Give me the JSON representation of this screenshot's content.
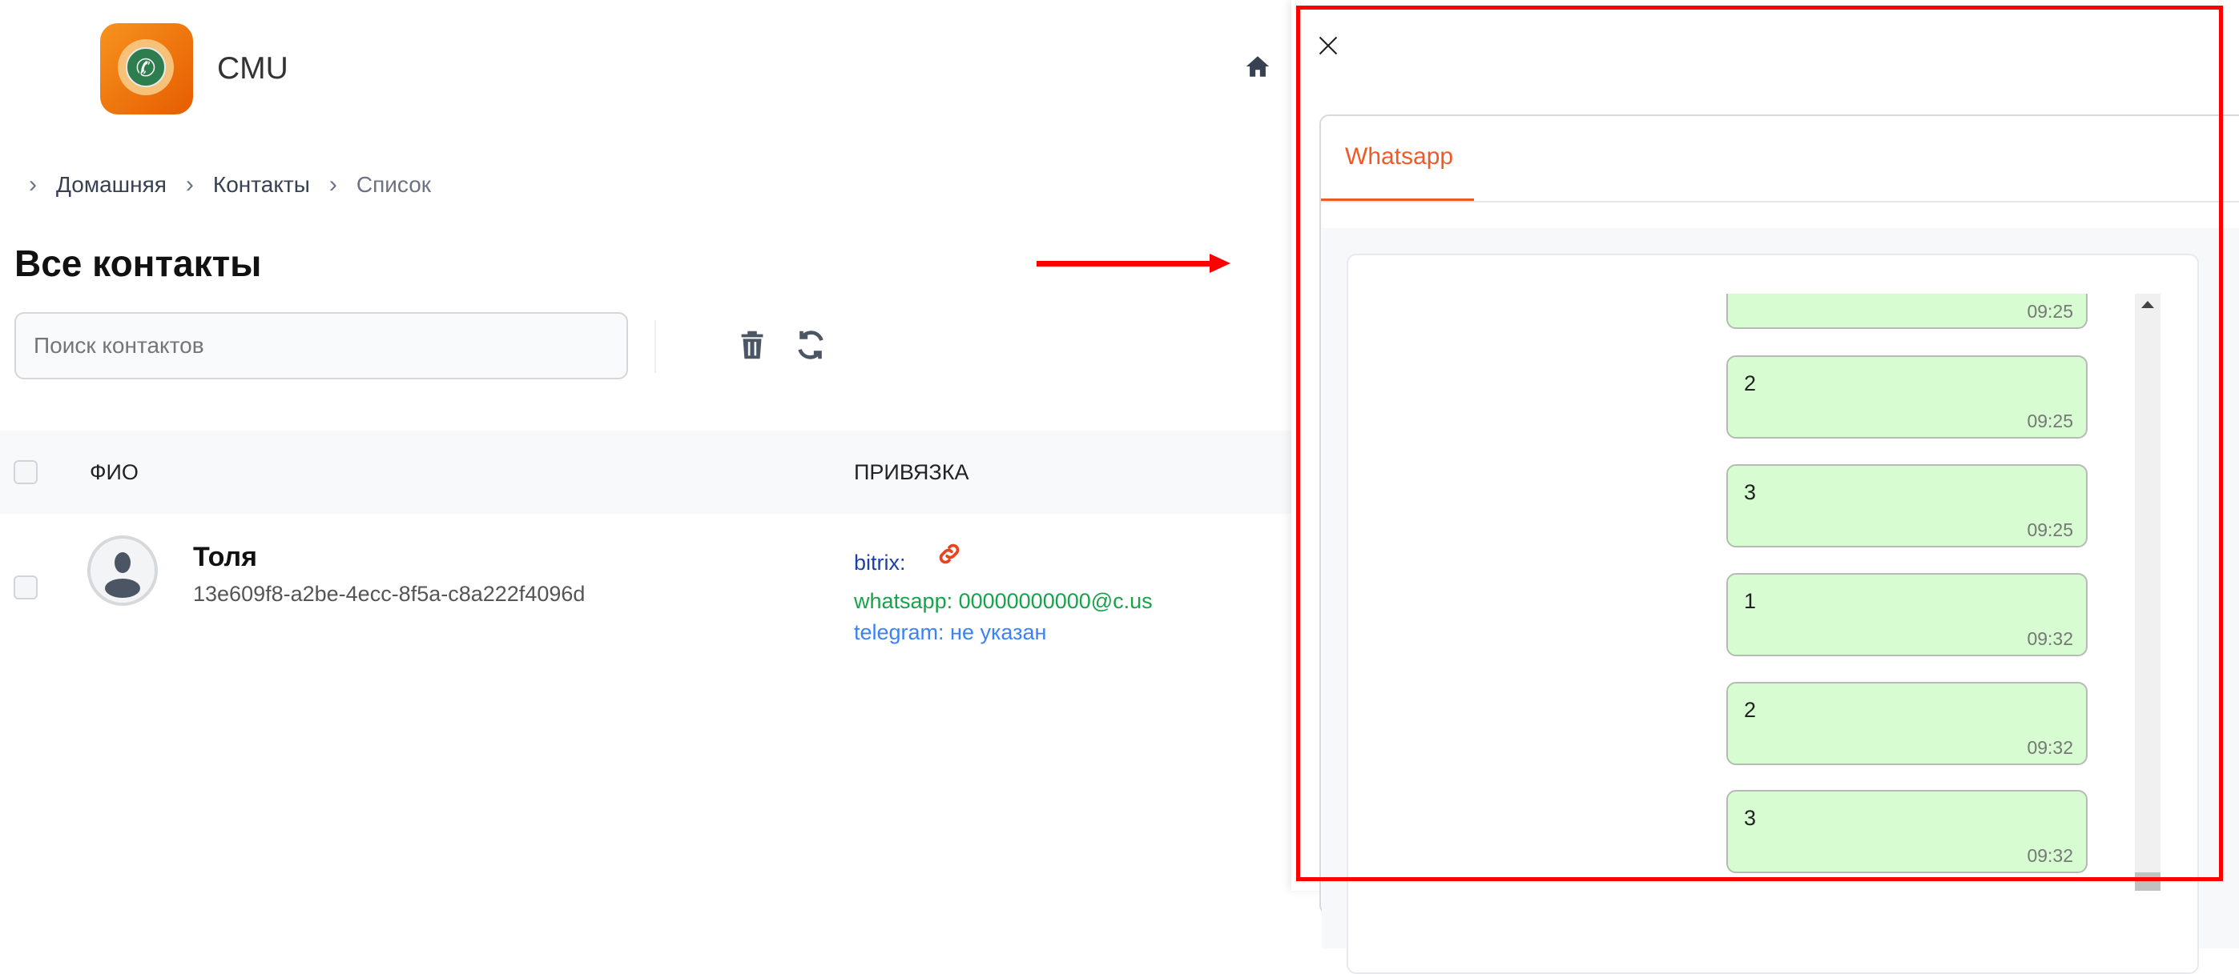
{
  "header": {
    "brand": "CMU",
    "logo_icon": "whatsapp-phone-icon",
    "home_icon": "home-icon"
  },
  "breadcrumb": [
    {
      "label": "Домашняя"
    },
    {
      "label": "Контакты"
    },
    {
      "label": "Список"
    }
  ],
  "page_title": "Все контакты",
  "search": {
    "placeholder": "Поиск контактов",
    "value": ""
  },
  "toolbar": {
    "delete_icon": "trash-icon",
    "refresh_icon": "refresh-icon"
  },
  "table": {
    "columns": [
      "ФИО",
      "ПРИВЯЗКА"
    ],
    "rows": [
      {
        "name": "Толя",
        "id": "13e609f8-a2be-4ecc-8f5a-c8a222f4096d",
        "bitrix": "bitrix:",
        "whatsapp": "whatsapp: 00000000000@c.us",
        "telegram": "telegram: не указан"
      }
    ]
  },
  "panel": {
    "tab": "Whatsapp",
    "messages": [
      {
        "text": "",
        "time": "09:25"
      },
      {
        "text": "2",
        "time": "09:25"
      },
      {
        "text": "3",
        "time": "09:25"
      },
      {
        "text": "1",
        "time": "09:32"
      },
      {
        "text": "2",
        "time": "09:32"
      },
      {
        "text": "3",
        "time": "09:32"
      }
    ]
  },
  "colors": {
    "accent": "#f05a28",
    "bubble": "#d7fcd2",
    "annotation": "#ff0000",
    "bitrix": "#1e40af",
    "whatsapp": "#16a34a",
    "telegram": "#3b82f6"
  }
}
